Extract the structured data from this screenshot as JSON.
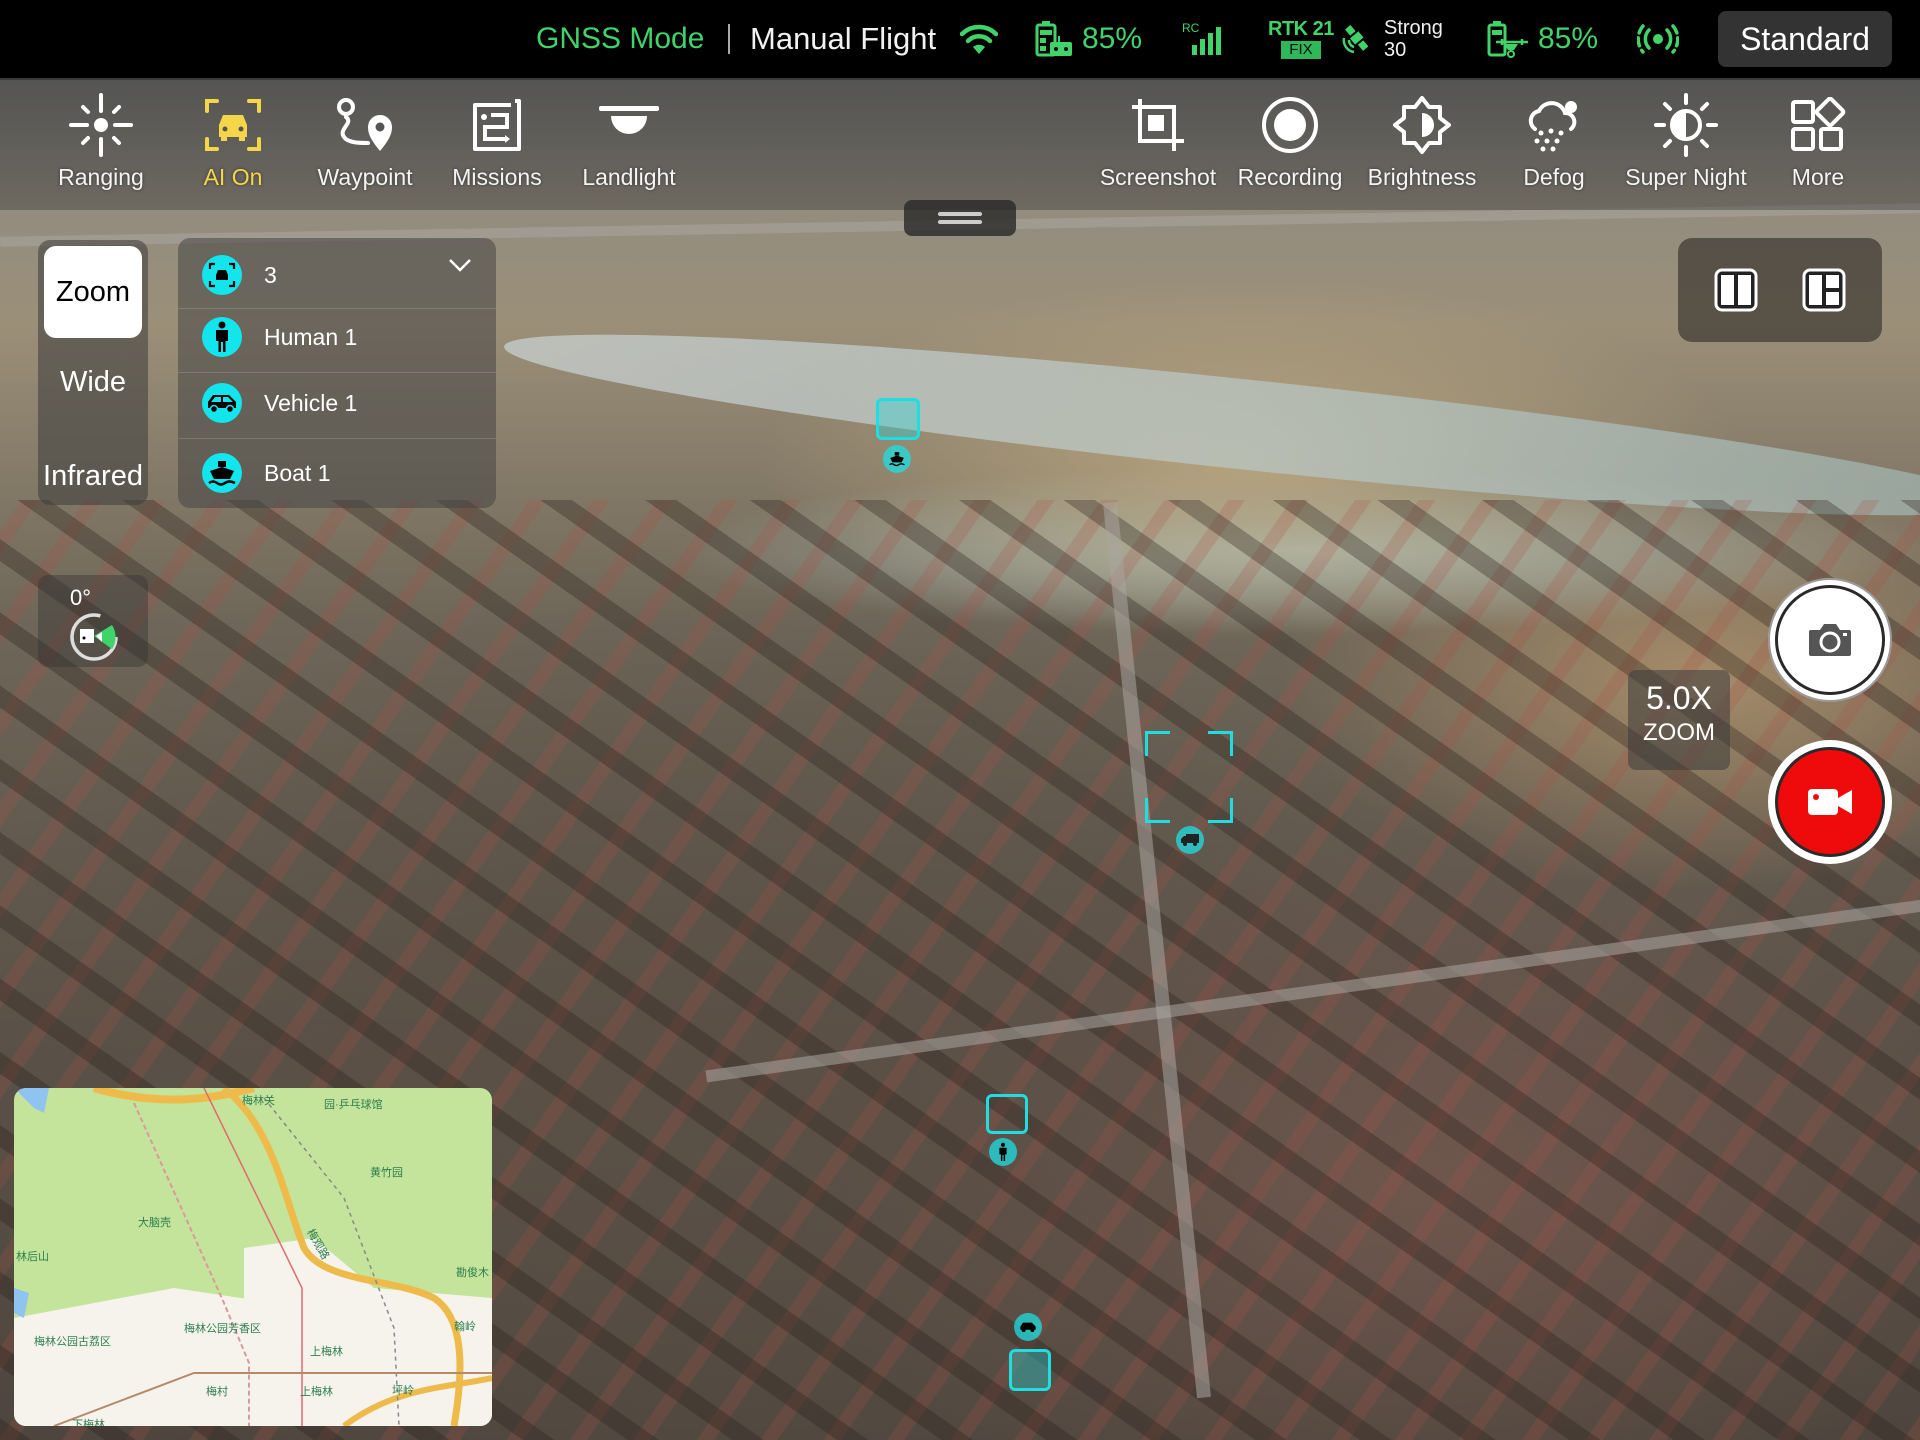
{
  "status_bar": {
    "positioning_mode": "GNSS Mode",
    "flight_mode": "Manual Flight",
    "wifi_icon": "wifi-icon",
    "rc_battery": "85%",
    "rc_signal_label": "RC",
    "rtk_label": "RTK",
    "rtk_count": "21",
    "rtk_status": "FIX",
    "satellite_strength": "Strong",
    "satellite_count": "30",
    "drone_battery": "85%",
    "beacon_icon": "beacon-icon",
    "speed_mode": "Standard",
    "colors": {
      "ok": "#3fd36a",
      "rtk_fix_bg": "#2fb85a"
    }
  },
  "toolbar": {
    "items": [
      {
        "id": "ranging",
        "label": "Ranging",
        "icon": "ranging-icon",
        "active": false
      },
      {
        "id": "ai",
        "label": "AI On",
        "icon": "ai-car-icon",
        "active": true
      },
      {
        "id": "waypoint",
        "label": "Waypoint",
        "icon": "waypoint-icon",
        "active": false
      },
      {
        "id": "missions",
        "label": "Missions",
        "icon": "missions-icon",
        "active": false
      },
      {
        "id": "landlight",
        "label": "Landlight",
        "icon": "landlight-icon",
        "active": false
      },
      {
        "id": "screenshot",
        "label": "Screenshot",
        "icon": "crop-icon",
        "active": false
      },
      {
        "id": "recording",
        "label": "Recording",
        "icon": "record-dot-icon",
        "active": false
      },
      {
        "id": "brightness",
        "label": "Brightness",
        "icon": "brightness-icon",
        "active": false
      },
      {
        "id": "defog",
        "label": "Defog",
        "icon": "defog-icon",
        "active": false
      },
      {
        "id": "super_night",
        "label": "Super Night",
        "icon": "super-night-icon",
        "active": false
      },
      {
        "id": "more",
        "label": "More",
        "icon": "more-grid-icon",
        "active": false
      }
    ],
    "active_color": "#f5d64a"
  },
  "lens": {
    "options": [
      "Zoom",
      "Wide",
      "Infrared"
    ],
    "selected": "Zoom"
  },
  "ai_panel": {
    "total": "3",
    "rows": [
      {
        "label": "Human 1",
        "icon": "human-icon"
      },
      {
        "label": "Vehicle 1",
        "icon": "vehicle-icon"
      },
      {
        "label": "Boat 1",
        "icon": "boat-icon"
      }
    ],
    "accent": "#12e6ec"
  },
  "gimbal": {
    "angle": "0°"
  },
  "camera": {
    "zoom_value": "5.0X",
    "zoom_label": "ZOOM",
    "record_color": "#ef0b0b"
  },
  "detections": [
    {
      "type": "boat"
    },
    {
      "type": "vehicle"
    },
    {
      "type": "human"
    },
    {
      "type": "vehicle"
    }
  ],
  "minimap": {
    "labels": [
      "梅林关",
      "园·乒乓球馆",
      "黄竹园",
      "大脑壳",
      "林后山",
      "梅观路",
      "勘俊木",
      "梅林公园古荔区",
      "梅林公园芳香区",
      "上梅林",
      "梅村",
      "上梅林",
      "翰岭",
      "下梅林",
      "坪岭"
    ]
  }
}
